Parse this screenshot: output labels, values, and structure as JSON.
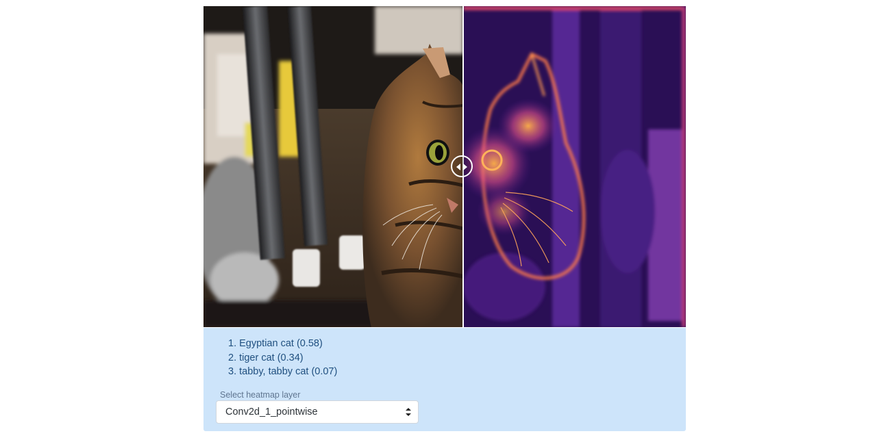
{
  "predictions": [
    "1. Egyptian cat (0.58)",
    "2. tiger cat (0.34)",
    "3. tabby, tabby cat (0.07)"
  ],
  "heatmap": {
    "label": "Select heatmap layer",
    "selected": "Conv2d_1_pointwise"
  },
  "icons": {
    "divider_handle": "left-right-arrows-icon",
    "select_caret": "up-down-caret-icon"
  },
  "colors": {
    "panel_bg": "#cde4fa",
    "prediction_text": "#1f4f7f",
    "heatmap_dark": "#2a0f55",
    "heatmap_hot": "#ff8c3a"
  }
}
